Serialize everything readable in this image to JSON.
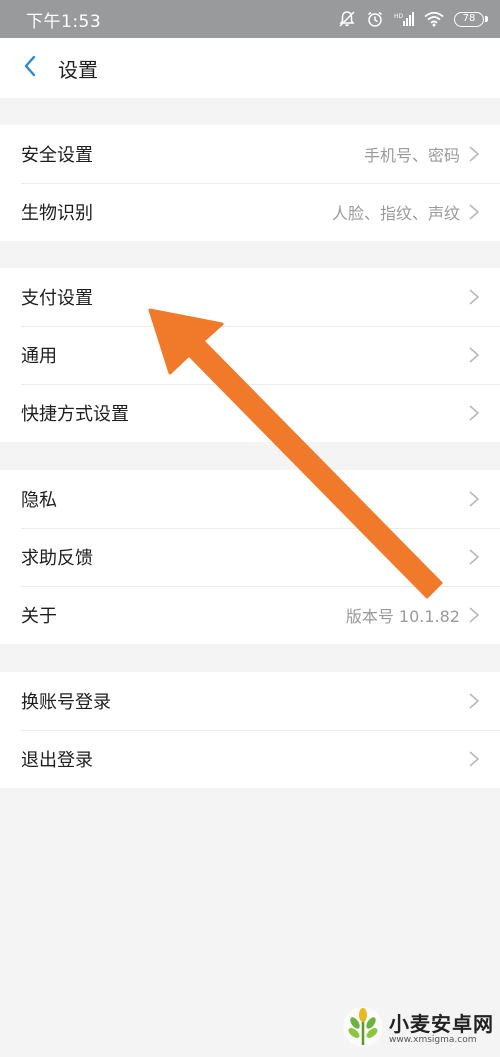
{
  "status_bar": {
    "time": "下午1:53",
    "battery": "78",
    "icons": [
      "mute-bell-icon",
      "alarm-icon",
      "signal-icon",
      "wifi-icon",
      "battery-icon"
    ]
  },
  "header": {
    "title": "设置",
    "back_icon": "chevron-left-icon",
    "accent_color": "#2a86d6"
  },
  "groups": [
    {
      "items": [
        {
          "label": "安全设置",
          "value": "手机号、密码"
        },
        {
          "label": "生物识别",
          "value": "人脸、指纹、声纹"
        }
      ]
    },
    {
      "items": [
        {
          "label": "支付设置",
          "value": ""
        },
        {
          "label": "通用",
          "value": ""
        },
        {
          "label": "快捷方式设置",
          "value": ""
        }
      ]
    },
    {
      "items": [
        {
          "label": "隐私",
          "value": ""
        },
        {
          "label": "求助反馈",
          "value": ""
        },
        {
          "label": "关于",
          "value": "版本号 10.1.82"
        }
      ]
    },
    {
      "items": [
        {
          "label": "换账号登录",
          "value": ""
        },
        {
          "label": "退出登录",
          "value": ""
        }
      ]
    }
  ],
  "annotation": {
    "type": "arrow",
    "color": "#f07a2a",
    "points_to": "支付设置"
  },
  "watermark": {
    "title": "小麦安卓网",
    "url": "www.xmsigma.com",
    "icon": "wheat-logo-icon"
  }
}
